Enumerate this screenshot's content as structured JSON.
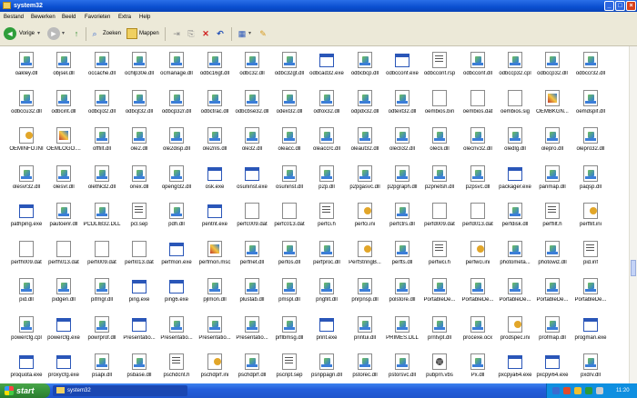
{
  "window": {
    "title": "system32"
  },
  "menu": [
    "Bestand",
    "Bewerken",
    "Beeld",
    "Favorieten",
    "Extra",
    "Help"
  ],
  "toolbar": {
    "back_label": "Vorige",
    "search_label": "Zoeken",
    "folders_label": "Mappen"
  },
  "rows": [
    [
      {
        "name": "oakley.dll",
        "icon": "dll"
      },
      {
        "name": "objsel.dll",
        "icon": "dll"
      },
      {
        "name": "occache.dll",
        "icon": "dll"
      },
      {
        "name": "ochlp30e.dll",
        "icon": "dll"
      },
      {
        "name": "ocmanage.dll",
        "icon": "dll"
      },
      {
        "name": "odbc16gt.dll",
        "icon": "dll"
      },
      {
        "name": "odbc32.dll",
        "icon": "dll"
      },
      {
        "name": "odbc32gt.dll",
        "icon": "dll"
      },
      {
        "name": "odbcad32.exe",
        "icon": "exe"
      },
      {
        "name": "odbcbcp.dll",
        "icon": "dll"
      },
      {
        "name": "odbcconf.exe",
        "icon": "exe"
      },
      {
        "name": "odbcconf.rsp",
        "icon": "txt"
      },
      {
        "name": "odbcconf.dll",
        "icon": "dll"
      },
      {
        "name": "odbccp32.cpl",
        "icon": "dll"
      },
      {
        "name": "odbccp32.dll",
        "icon": "dll"
      },
      {
        "name": "odbccr32.dll",
        "icon": "dll"
      }
    ],
    [
      {
        "name": "odbccu32.dll",
        "icon": "dll"
      },
      {
        "name": "odbcint.dll",
        "icon": "dll"
      },
      {
        "name": "odbcji32.dll",
        "icon": "dll"
      },
      {
        "name": "odbcjt32.dll",
        "icon": "dll"
      },
      {
        "name": "odbcp32r.dll",
        "icon": "dll"
      },
      {
        "name": "odbctrac.dll",
        "icon": "dll"
      },
      {
        "name": "odbcbse32.dll",
        "icon": "dll"
      },
      {
        "name": "odexl32.dll",
        "icon": "dll"
      },
      {
        "name": "odfox32.dll",
        "icon": "dll"
      },
      {
        "name": "odpdx32.dll",
        "icon": "dll"
      },
      {
        "name": "odtext32.dll",
        "icon": "dll"
      },
      {
        "name": "oembios.bin",
        "icon": "bin"
      },
      {
        "name": "oembios.dat",
        "icon": "bin"
      },
      {
        "name": "oembios.sig",
        "icon": "bin"
      },
      {
        "name": "OEMBKGN...",
        "icon": "img"
      },
      {
        "name": "oemdspif.dll",
        "icon": "dll"
      }
    ],
    [
      {
        "name": "OEMINFO.INI",
        "icon": "ini"
      },
      {
        "name": "OEMLOGO....",
        "icon": "img"
      },
      {
        "name": "offfilt.dll",
        "icon": "dll"
      },
      {
        "name": "ole2.dll",
        "icon": "dll"
      },
      {
        "name": "ole2disp.dll",
        "icon": "dll"
      },
      {
        "name": "ole2nls.dll",
        "icon": "dll"
      },
      {
        "name": "ole32.dll",
        "icon": "dll"
      },
      {
        "name": "oleacc.dll",
        "icon": "dll"
      },
      {
        "name": "oleaccrc.dll",
        "icon": "dll"
      },
      {
        "name": "oleaut32.dll",
        "icon": "dll"
      },
      {
        "name": "olecli32.dll",
        "icon": "dll"
      },
      {
        "name": "olecli.dll",
        "icon": "dll"
      },
      {
        "name": "olecnv32.dll",
        "icon": "dll"
      },
      {
        "name": "oledlg.dll",
        "icon": "dll"
      },
      {
        "name": "olepro.dll",
        "icon": "dll"
      },
      {
        "name": "olepro32.dll",
        "icon": "dll"
      }
    ],
    [
      {
        "name": "olesvr32.dll",
        "icon": "dll"
      },
      {
        "name": "olesvr.dll",
        "icon": "dll"
      },
      {
        "name": "olethk32.dll",
        "icon": "dll"
      },
      {
        "name": "onex.dll",
        "icon": "dll"
      },
      {
        "name": "opengl32.dll",
        "icon": "dll"
      },
      {
        "name": "osk.exe",
        "icon": "exe"
      },
      {
        "name": "osuninst.exe",
        "icon": "exe"
      },
      {
        "name": "osuninst.dll",
        "icon": "dll"
      },
      {
        "name": "p2p.dll",
        "icon": "dll"
      },
      {
        "name": "p2pgasvc.dll",
        "icon": "dll"
      },
      {
        "name": "p2pgraph.dll",
        "icon": "dll"
      },
      {
        "name": "p2pnetsh.dll",
        "icon": "dll"
      },
      {
        "name": "p2psvc.dll",
        "icon": "dll"
      },
      {
        "name": "packager.exe",
        "icon": "exe"
      },
      {
        "name": "panmap.dll",
        "icon": "dll"
      },
      {
        "name": "paqsp.dll",
        "icon": "dll"
      }
    ],
    [
      {
        "name": "pathping.exe",
        "icon": "exe"
      },
      {
        "name": "pautoenr.dll",
        "icon": "dll"
      },
      {
        "name": "PCDLIB32.DLL",
        "icon": "dll"
      },
      {
        "name": "pcl.sep",
        "icon": "txt"
      },
      {
        "name": "pdh.dll",
        "icon": "dll"
      },
      {
        "name": "pentnt.exe",
        "icon": "exe"
      },
      {
        "name": "perfc009.dat",
        "icon": "bin"
      },
      {
        "name": "perfc013.dat",
        "icon": "bin"
      },
      {
        "name": "perfci.h",
        "icon": "txt"
      },
      {
        "name": "perfci.ini",
        "icon": "ini"
      },
      {
        "name": "perfctrs.dll",
        "icon": "dll"
      },
      {
        "name": "perfd009.dat",
        "icon": "bin"
      },
      {
        "name": "perfd013.dat",
        "icon": "bin"
      },
      {
        "name": "perfdisk.dll",
        "icon": "dll"
      },
      {
        "name": "perffilt.h",
        "icon": "txt"
      },
      {
        "name": "perffilt.ini",
        "icon": "ini"
      }
    ],
    [
      {
        "name": "perfh009.dat",
        "icon": "bin"
      },
      {
        "name": "perfh013.dat",
        "icon": "bin"
      },
      {
        "name": "perfi009.dat",
        "icon": "bin"
      },
      {
        "name": "perfi013.dat",
        "icon": "bin"
      },
      {
        "name": "perfmon.exe",
        "icon": "exe"
      },
      {
        "name": "perfmon.msc",
        "icon": "img"
      },
      {
        "name": "perfnet.dll",
        "icon": "dll"
      },
      {
        "name": "perfos.dll",
        "icon": "dll"
      },
      {
        "name": "perfproc.dll",
        "icon": "dll"
      },
      {
        "name": "PerfStringB...",
        "icon": "ini"
      },
      {
        "name": "perfts.dll",
        "icon": "dll"
      },
      {
        "name": "perfwci.h",
        "icon": "txt"
      },
      {
        "name": "perfwci.ini",
        "icon": "ini"
      },
      {
        "name": "photometa...",
        "icon": "dll"
      },
      {
        "name": "photowiz.dll",
        "icon": "dll"
      },
      {
        "name": "pid.inf",
        "icon": "txt"
      }
    ],
    [
      {
        "name": "pid.dll",
        "icon": "dll"
      },
      {
        "name": "pidgen.dll",
        "icon": "dll"
      },
      {
        "name": "pifmgr.dll",
        "icon": "dll"
      },
      {
        "name": "ping.exe",
        "icon": "exe"
      },
      {
        "name": "ping6.exe",
        "icon": "exe"
      },
      {
        "name": "pjlmon.dll",
        "icon": "dll"
      },
      {
        "name": "plustab.dll",
        "icon": "dll"
      },
      {
        "name": "pmspl.dll",
        "icon": "dll"
      },
      {
        "name": "pngfilt.dll",
        "icon": "dll"
      },
      {
        "name": "pnrpnsp.dll",
        "icon": "dll"
      },
      {
        "name": "polstore.dll",
        "icon": "dll"
      },
      {
        "name": "PortableDe...",
        "icon": "dll"
      },
      {
        "name": "PortableDe...",
        "icon": "dll"
      },
      {
        "name": "PortableDe...",
        "icon": "dll"
      },
      {
        "name": "PortableDe...",
        "icon": "dll"
      },
      {
        "name": "PortableDe...",
        "icon": "dll"
      }
    ],
    [
      {
        "name": "powercfg.cpl",
        "icon": "dll"
      },
      {
        "name": "powercfg.exe",
        "icon": "exe"
      },
      {
        "name": "powrprof.dll",
        "icon": "dll"
      },
      {
        "name": "Presentatio...",
        "icon": "exe"
      },
      {
        "name": "Presentatio...",
        "icon": "dll"
      },
      {
        "name": "Presentatio...",
        "icon": "dll"
      },
      {
        "name": "Presentatio...",
        "icon": "dll"
      },
      {
        "name": "prflbmsg.dll",
        "icon": "dll"
      },
      {
        "name": "print.exe",
        "icon": "exe"
      },
      {
        "name": "printui.dll",
        "icon": "dll"
      },
      {
        "name": "PRIMES.DLL",
        "icon": "dll"
      },
      {
        "name": "prntvpt.dll",
        "icon": "dll"
      },
      {
        "name": "procexe.ocx",
        "icon": "dll"
      },
      {
        "name": "prodspec.ini",
        "icon": "ini"
      },
      {
        "name": "profmap.dll",
        "icon": "dll"
      },
      {
        "name": "progman.exe",
        "icon": "exe"
      }
    ],
    [
      {
        "name": "proquota.exe",
        "icon": "exe"
      },
      {
        "name": "proxycfg.exe",
        "icon": "exe"
      },
      {
        "name": "psapi.dll",
        "icon": "dll"
      },
      {
        "name": "psbase.dll",
        "icon": "dll"
      },
      {
        "name": "pschdcnt.h",
        "icon": "txt"
      },
      {
        "name": "pschdprf.ini",
        "icon": "ini"
      },
      {
        "name": "pschdprf.dll",
        "icon": "dll"
      },
      {
        "name": "pscript.sep",
        "icon": "txt"
      },
      {
        "name": "psnppagn.dll",
        "icon": "dll"
      },
      {
        "name": "pstorec.dll",
        "icon": "dll"
      },
      {
        "name": "pstorsvc.dll",
        "icon": "dll"
      },
      {
        "name": "pubprn.vbs",
        "icon": "gear"
      },
      {
        "name": "Px.dll",
        "icon": "dll"
      },
      {
        "name": "pxcpya64.exe",
        "icon": "exe"
      },
      {
        "name": "pxcpyi64.exe",
        "icon": "exe"
      },
      {
        "name": "pxdrv.dll",
        "icon": "dll"
      }
    ]
  ],
  "taskbar": {
    "start_label": "start",
    "task_label": "system32",
    "clock": "11:20"
  }
}
